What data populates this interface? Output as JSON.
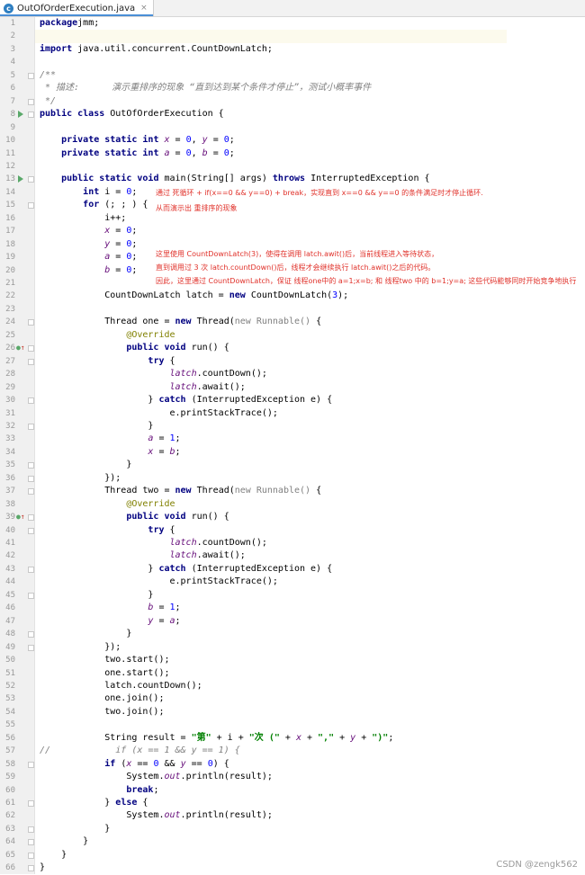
{
  "tab": {
    "filename": "OutOfOrderExecution.java",
    "icon_letter": "c",
    "close": "×"
  },
  "lines": [
    {
      "n": "1"
    },
    {
      "n": "2"
    },
    {
      "n": "3"
    },
    {
      "n": "4"
    },
    {
      "n": "5"
    },
    {
      "n": "6"
    },
    {
      "n": "7"
    },
    {
      "n": "8"
    },
    {
      "n": "9"
    },
    {
      "n": "10"
    },
    {
      "n": "11"
    },
    {
      "n": "12"
    },
    {
      "n": "13"
    },
    {
      "n": "14"
    },
    {
      "n": "15"
    },
    {
      "n": "16"
    },
    {
      "n": "17"
    },
    {
      "n": "18"
    },
    {
      "n": "19"
    },
    {
      "n": "20"
    },
    {
      "n": "21"
    },
    {
      "n": "22"
    },
    {
      "n": "23"
    },
    {
      "n": "24"
    },
    {
      "n": "25"
    },
    {
      "n": "26"
    },
    {
      "n": "27"
    },
    {
      "n": "28"
    },
    {
      "n": "29"
    },
    {
      "n": "30"
    },
    {
      "n": "31"
    },
    {
      "n": "32"
    },
    {
      "n": "33"
    },
    {
      "n": "34"
    },
    {
      "n": "35"
    },
    {
      "n": "36"
    },
    {
      "n": "37"
    },
    {
      "n": "38"
    },
    {
      "n": "39"
    },
    {
      "n": "40"
    },
    {
      "n": "41"
    },
    {
      "n": "42"
    },
    {
      "n": "43"
    },
    {
      "n": "44"
    },
    {
      "n": "45"
    },
    {
      "n": "46"
    },
    {
      "n": "47"
    },
    {
      "n": "48"
    },
    {
      "n": "49"
    },
    {
      "n": "50"
    },
    {
      "n": "51"
    },
    {
      "n": "52"
    },
    {
      "n": "53"
    },
    {
      "n": "54"
    },
    {
      "n": "55"
    },
    {
      "n": "56"
    },
    {
      "n": "57"
    },
    {
      "n": "58"
    },
    {
      "n": "59"
    },
    {
      "n": "60"
    },
    {
      "n": "61"
    },
    {
      "n": "62"
    },
    {
      "n": "63"
    },
    {
      "n": "64"
    },
    {
      "n": "65"
    },
    {
      "n": "66"
    }
  ],
  "code": {
    "l1": [
      [
        "kw",
        "package"
      ],
      [
        "",
        "jmm;"
      ]
    ],
    "l2": [],
    "l3": [
      [
        "kw",
        "import"
      ],
      [
        "",
        " java.util.concurrent.CountDownLatch;"
      ]
    ],
    "l4": [],
    "l5": [
      [
        "cmt",
        "/**"
      ]
    ],
    "l6": [
      [
        "cmt",
        " * 描述:      演示重排序的现象 “直到达到某个条件才停止”，测试小概率事件"
      ]
    ],
    "l7": [
      [
        "cmt",
        " */"
      ]
    ],
    "l8": [
      [
        "kw",
        "public class"
      ],
      [
        "",
        " OutOfOrderExecution {"
      ]
    ],
    "l9": [],
    "l10": [
      [
        "",
        "    "
      ],
      [
        "kw",
        "private static int "
      ],
      [
        "st",
        "x"
      ],
      [
        "",
        " = "
      ],
      [
        "num",
        "0"
      ],
      [
        "",
        ", "
      ],
      [
        "st",
        "y"
      ],
      [
        "",
        " = "
      ],
      [
        "num",
        "0"
      ],
      [
        "",
        ";"
      ]
    ],
    "l11": [
      [
        "",
        "    "
      ],
      [
        "kw",
        "private static int "
      ],
      [
        "st",
        "a"
      ],
      [
        "",
        " = "
      ],
      [
        "num",
        "0"
      ],
      [
        "",
        ", "
      ],
      [
        "st",
        "b"
      ],
      [
        "",
        " = "
      ],
      [
        "num",
        "0"
      ],
      [
        "",
        ";"
      ]
    ],
    "l12": [],
    "l13": [
      [
        "",
        "    "
      ],
      [
        "kw",
        "public static void "
      ],
      [
        "",
        "main(String[] args) "
      ],
      [
        "kw",
        "throws "
      ],
      [
        "",
        "InterruptedException {"
      ]
    ],
    "l14": [
      [
        "",
        "        "
      ],
      [
        "kw",
        "int "
      ],
      [
        "",
        "i = "
      ],
      [
        "num",
        "0"
      ],
      [
        "",
        ";"
      ]
    ],
    "l15": [
      [
        "",
        "        "
      ],
      [
        "kw",
        "for "
      ],
      [
        "",
        "(; ; ) {"
      ]
    ],
    "l16": [
      [
        "",
        "            i++;"
      ]
    ],
    "l17": [
      [
        "",
        "            "
      ],
      [
        "st",
        "x"
      ],
      [
        "",
        " = "
      ],
      [
        "num",
        "0"
      ],
      [
        "",
        ";"
      ]
    ],
    "l18": [
      [
        "",
        "            "
      ],
      [
        "st",
        "y"
      ],
      [
        "",
        " = "
      ],
      [
        "num",
        "0"
      ],
      [
        "",
        ";"
      ]
    ],
    "l19": [
      [
        "",
        "            "
      ],
      [
        "st",
        "a"
      ],
      [
        "",
        " = "
      ],
      [
        "num",
        "0"
      ],
      [
        "",
        ";"
      ]
    ],
    "l20": [
      [
        "",
        "            "
      ],
      [
        "st",
        "b"
      ],
      [
        "",
        " = "
      ],
      [
        "num",
        "0"
      ],
      [
        "",
        ";"
      ]
    ],
    "l21": [],
    "l22": [
      [
        "",
        "            CountDownLatch latch = "
      ],
      [
        "kw",
        "new "
      ],
      [
        "",
        "CountDownLatch("
      ],
      [
        "num",
        "3"
      ],
      [
        "",
        ");"
      ]
    ],
    "l23": [],
    "l24": [
      [
        "",
        "            Thread one = "
      ],
      [
        "kw",
        "new "
      ],
      [
        "",
        "Thread("
      ],
      [
        "gry",
        "new Runnable() "
      ],
      [
        "",
        "{"
      ]
    ],
    "l25": [
      [
        "",
        "                "
      ],
      [
        "ann",
        "@Override"
      ]
    ],
    "l26": [
      [
        "",
        "                "
      ],
      [
        "kw",
        "public void "
      ],
      [
        "",
        "run() {"
      ]
    ],
    "l27": [
      [
        "",
        "                    "
      ],
      [
        "kw",
        "try "
      ],
      [
        "",
        "{"
      ]
    ],
    "l28": [
      [
        "",
        "                        "
      ],
      [
        "fld",
        "latch"
      ],
      [
        "",
        ".countDown();"
      ]
    ],
    "l29": [
      [
        "",
        "                        "
      ],
      [
        "fld",
        "latch"
      ],
      [
        "",
        ".await();"
      ]
    ],
    "l30": [
      [
        "",
        "                    } "
      ],
      [
        "kw",
        "catch "
      ],
      [
        "",
        "(InterruptedException e) {"
      ]
    ],
    "l31": [
      [
        "",
        "                        e.printStackTrace();"
      ]
    ],
    "l32": [
      [
        "",
        "                    }"
      ]
    ],
    "l33": [
      [
        "",
        "                    "
      ],
      [
        "st",
        "a"
      ],
      [
        "",
        " = "
      ],
      [
        "num",
        "1"
      ],
      [
        "",
        ";"
      ]
    ],
    "l34": [
      [
        "",
        "                    "
      ],
      [
        "st",
        "x"
      ],
      [
        "",
        " = "
      ],
      [
        "st",
        "b"
      ],
      [
        "",
        ";"
      ]
    ],
    "l35": [
      [
        "",
        "                }"
      ]
    ],
    "l36": [
      [
        "",
        "            });"
      ]
    ],
    "l37": [
      [
        "",
        "            Thread two = "
      ],
      [
        "kw",
        "new "
      ],
      [
        "",
        "Thread("
      ],
      [
        "gry",
        "new Runnable() "
      ],
      [
        "",
        "{"
      ]
    ],
    "l38": [
      [
        "",
        "                "
      ],
      [
        "ann",
        "@Override"
      ]
    ],
    "l39": [
      [
        "",
        "                "
      ],
      [
        "kw",
        "public void "
      ],
      [
        "",
        "run() {"
      ]
    ],
    "l40": [
      [
        "",
        "                    "
      ],
      [
        "kw",
        "try "
      ],
      [
        "",
        "{"
      ]
    ],
    "l41": [
      [
        "",
        "                        "
      ],
      [
        "fld",
        "latch"
      ],
      [
        "",
        ".countDown();"
      ]
    ],
    "l42": [
      [
        "",
        "                        "
      ],
      [
        "fld",
        "latch"
      ],
      [
        "",
        ".await();"
      ]
    ],
    "l43": [
      [
        "",
        "                    } "
      ],
      [
        "kw",
        "catch "
      ],
      [
        "",
        "(InterruptedException e) {"
      ]
    ],
    "l44": [
      [
        "",
        "                        e.printStackTrace();"
      ]
    ],
    "l45": [
      [
        "",
        "                    }"
      ]
    ],
    "l46": [
      [
        "",
        "                    "
      ],
      [
        "st",
        "b"
      ],
      [
        "",
        " = "
      ],
      [
        "num",
        "1"
      ],
      [
        "",
        ";"
      ]
    ],
    "l47": [
      [
        "",
        "                    "
      ],
      [
        "st",
        "y"
      ],
      [
        "",
        " = "
      ],
      [
        "st",
        "a"
      ],
      [
        "",
        ";"
      ]
    ],
    "l48": [
      [
        "",
        "                }"
      ]
    ],
    "l49": [
      [
        "",
        "            });"
      ]
    ],
    "l50": [
      [
        "",
        "            two.start();"
      ]
    ],
    "l51": [
      [
        "",
        "            one.start();"
      ]
    ],
    "l52": [
      [
        "",
        "            latch.countDown();"
      ]
    ],
    "l53": [
      [
        "",
        "            one.join();"
      ]
    ],
    "l54": [
      [
        "",
        "            two.join();"
      ]
    ],
    "l55": [],
    "l56": [
      [
        "",
        "            String result = "
      ],
      [
        "str",
        "\"第\""
      ],
      [
        "",
        " + i + "
      ],
      [
        "str",
        "\"次 (\""
      ],
      [
        "",
        " + "
      ],
      [
        "st",
        "x"
      ],
      [
        "",
        " + "
      ],
      [
        "str",
        "\",\""
      ],
      [
        "",
        " + "
      ],
      [
        "st",
        "y"
      ],
      [
        "",
        " + "
      ],
      [
        "str",
        "\")\""
      ],
      [
        "",
        ";"
      ]
    ],
    "l57": [
      [
        "cmt",
        "//            if (x == 1 && y == 1) {"
      ]
    ],
    "l58": [
      [
        "",
        "            "
      ],
      [
        "kw",
        "if "
      ],
      [
        "",
        "("
      ],
      [
        "st",
        "x"
      ],
      [
        "",
        " == "
      ],
      [
        "num",
        "0"
      ],
      [
        "",
        " && "
      ],
      [
        "st",
        "y"
      ],
      [
        "",
        " == "
      ],
      [
        "num",
        "0"
      ],
      [
        "",
        ") {"
      ]
    ],
    "l59": [
      [
        "",
        "                System."
      ],
      [
        "st",
        "out"
      ],
      [
        "",
        ".println(result);"
      ]
    ],
    "l60": [
      [
        "",
        "                "
      ],
      [
        "kw",
        "break"
      ],
      [
        "",
        ";"
      ]
    ],
    "l61": [
      [
        "",
        "            } "
      ],
      [
        "kw",
        "else "
      ],
      [
        "",
        "{"
      ]
    ],
    "l62": [
      [
        "",
        "                System."
      ],
      [
        "st",
        "out"
      ],
      [
        "",
        ".println(result);"
      ]
    ],
    "l63": [
      [
        "",
        "            }"
      ]
    ],
    "l64": [
      [
        "",
        "        }"
      ]
    ],
    "l65": [
      [
        "",
        "    }"
      ]
    ],
    "l66": [
      [
        "",
        "}"
      ]
    ]
  },
  "notes": {
    "n1": "通过 死循环 + if(x==0 && y==0) + break，实现直到 x==0 && y==0 的条件满足时才停止循环.",
    "n2": "从而演示出 重排序的现象",
    "n3": "这里使用 CountDownLatch(3)，使得在调用 latch.awit()后，当前线程进入等待状态，",
    "n4": "直到调用过 3 次 latch.countDown()后，线程才会继续执行 latch.awit()之后的代码。",
    "n5": "因此，这里通过 CountDownLatch，保证 线程one中的 a=1;x=b; 和 线程two 中的 b=1;y=a; 这些代码能够同时开始竞争地执行"
  },
  "watermark": "CSDN @zengk562",
  "colors": {
    "keyword": "#000080",
    "string": "#008000",
    "number": "#0000ff",
    "field": "#660e7a",
    "comment": "#808080",
    "annotation": "#808000",
    "note": "#e0312a"
  }
}
